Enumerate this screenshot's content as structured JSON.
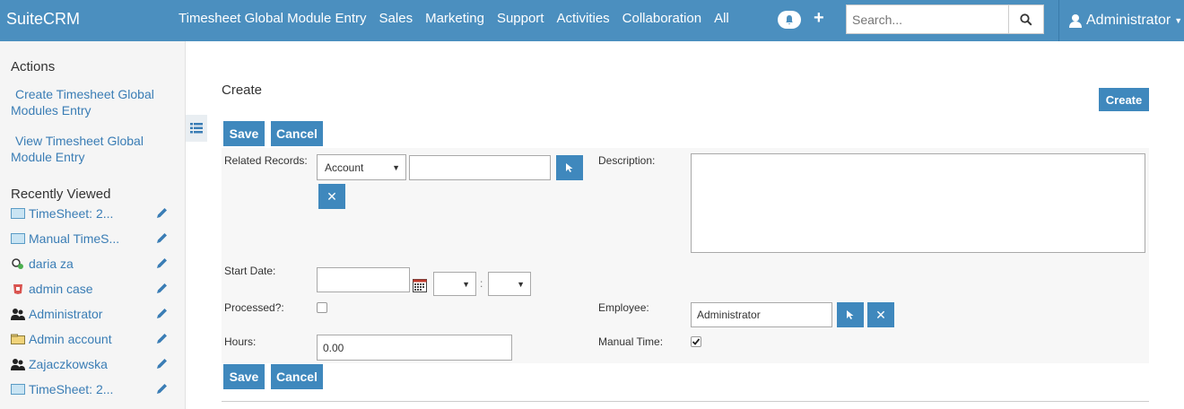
{
  "header": {
    "logo": "SuiteCRM",
    "nav": [
      "Timesheet Global Module Entry",
      "Sales",
      "Marketing",
      "Support",
      "Activities",
      "Collaboration",
      "All"
    ],
    "search_placeholder": "Search...",
    "user": "Administrator",
    "bar_color": "#4b8fbf"
  },
  "sidebar": {
    "actions_title": "Actions",
    "actions": [
      "Create Timesheet Global Modules Entry",
      "View Timesheet Global Module Entry"
    ],
    "recent_title": "Recently Viewed",
    "recent": [
      {
        "label": "TimeSheet: 2...",
        "icon": "timesheet-icon"
      },
      {
        "label": "Manual TimeS...",
        "icon": "timesheet-icon"
      },
      {
        "label": "daria za",
        "icon": "lead-icon"
      },
      {
        "label": "admin case",
        "icon": "case-icon"
      },
      {
        "label": "Administrator",
        "icon": "user-icon"
      },
      {
        "label": "Admin account",
        "icon": "account-icon"
      },
      {
        "label": "Zajaczkowska",
        "icon": "contact-icon"
      },
      {
        "label": "TimeSheet: 2...",
        "icon": "timesheet-icon"
      }
    ]
  },
  "main": {
    "title": "Create",
    "create_button": "Create",
    "save_label": "Save",
    "cancel_label": "Cancel",
    "form": {
      "related_records_label": "Related Records:",
      "related_type": "Account",
      "related_value": "",
      "description_label": "Description:",
      "description_value": "",
      "start_date_label": "Start Date:",
      "start_date_value": "",
      "time_sep": ":",
      "processed_label": "Processed?:",
      "processed_checked": false,
      "employee_label": "Employee:",
      "employee_value": "Administrator",
      "hours_label": "Hours:",
      "hours_value": "0.00",
      "manual_time_label": "Manual Time:",
      "manual_time_checked": true
    }
  }
}
